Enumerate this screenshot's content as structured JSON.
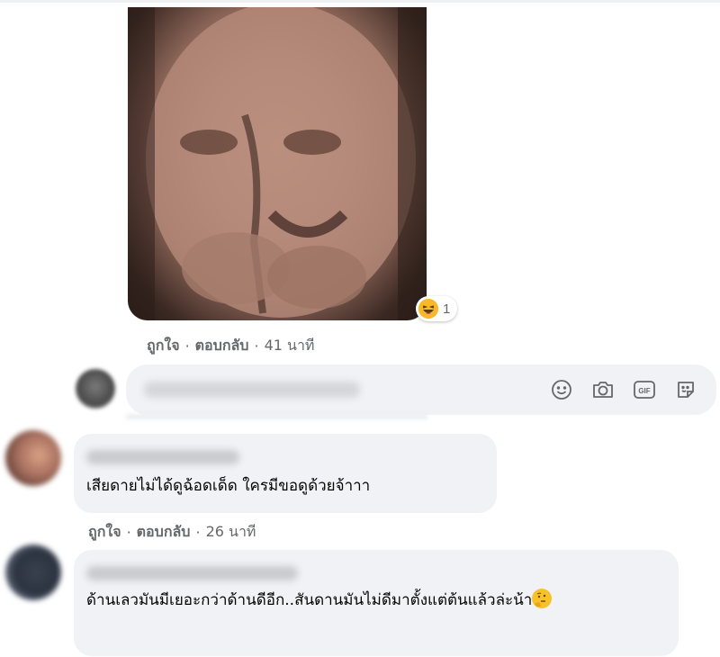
{
  "post_comment": {
    "reaction": {
      "icon": "laughing-emoji-icon",
      "count": "1"
    },
    "actions": {
      "like": "ถูกใจ",
      "reply": "ตอบกลับ",
      "separator": "·",
      "time": "41 นาที"
    }
  },
  "composer": {
    "icons": [
      "emoji-icon",
      "camera-icon",
      "gif-icon",
      "sticker-icon"
    ]
  },
  "comments": [
    {
      "text": "เสียดายไม่ได้ดูฉ้อดเด็ด ใครมีขอดูด้วยจ้าาา",
      "actions": {
        "like": "ถูกใจ",
        "reply": "ตอบกลับ",
        "separator": "·",
        "time": "26 นาที"
      }
    },
    {
      "text": "ด้านเลวมันมีเยอะกว่าด้านดีอีก..สันดานมันไม่ดีมาตั้งแต่ต้นแล้วล่ะน้า",
      "emoji": "thinking-face-emoji-icon"
    }
  ],
  "colors": {
    "bubble": "#f0f2f5",
    "secondary_text": "#65676b",
    "reaction_yellow": "#f7b928"
  }
}
